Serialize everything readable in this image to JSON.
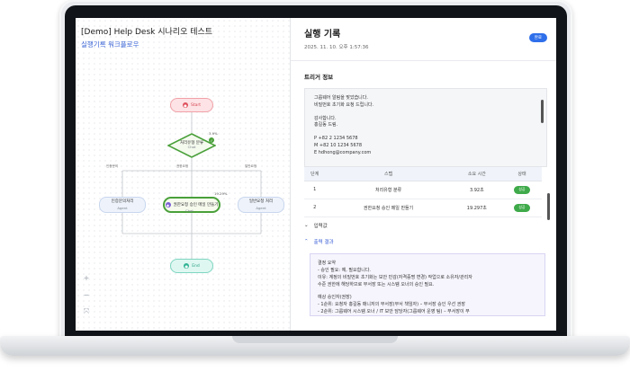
{
  "workflow": {
    "title": "[Demo] Help Desk 시나리오 테스트",
    "subtitle": "실행기록 워크플로우",
    "nodes": {
      "start": "Start",
      "classify": {
        "label": "처리유형 분류",
        "type": "Chat",
        "pct": "3.9%"
      },
      "left_agent": {
        "label": "인증문의처리",
        "type": "Agent"
      },
      "center_agent": {
        "label": "권한요청 승인 메일 만들기",
        "type": "Chat",
        "pct": "19.29%"
      },
      "right_agent": {
        "label": "일반요청 처리",
        "type": "Agent"
      },
      "end": "End"
    },
    "branches": [
      "인증문의",
      "권한요청",
      "일반요청"
    ],
    "zoom_controls": [
      "+",
      "−",
      "⤧"
    ]
  },
  "record": {
    "title": "실행 기록",
    "timestamp": "2025. 11. 10. 오후 1:57:36",
    "status_badge": "완료",
    "trigger_section": "트리거 정보",
    "trigger_lines": [
      "그룹웨어 알림을 맞았습니다.",
      "비밀번호 초기화 요청 드립니다.",
      "",
      "감사합니다.",
      "홍길동 드림.",
      "",
      "P  +82 2 1234 5678",
      "M  +82 10 1234 5678",
      "E  hdhong@company.com"
    ],
    "table": {
      "headers": [
        "단계",
        "스텝",
        "소요 시간",
        "상태"
      ],
      "rows": [
        {
          "step_no": "1",
          "step": "처리유형 분류",
          "duration": "3.92초",
          "status": "성공"
        },
        {
          "step_no": "2",
          "step": "권한요청 승인 메일 만들기",
          "duration": "19.297초",
          "status": "성공"
        }
      ]
    },
    "input_toggle": "입력값",
    "output_toggle": "출력 결과",
    "output_lines": [
      "결정 요약",
      "- 승인 필요: 예, 필요합니다.",
      "  이유: 계정의 비밀번호 초기화는 보안 민감(자격증명 변경) 작업으로 소유자/관리자",
      "  수준 권한에 해당하므로 부서장 또는 시스템 오너의 승인 필요.",
      "",
      "예상 승인자(권장)",
      "- 1순위: 요청자 홍길동 매니저의 부서장(부서 책임자) – 부서장 승인 우선 권장",
      "- 2순위: 그룹웨어 시스템 오너 / IT 보안 담당자(그룹웨어 운영 팀) – 부서장이 부"
    ]
  }
}
